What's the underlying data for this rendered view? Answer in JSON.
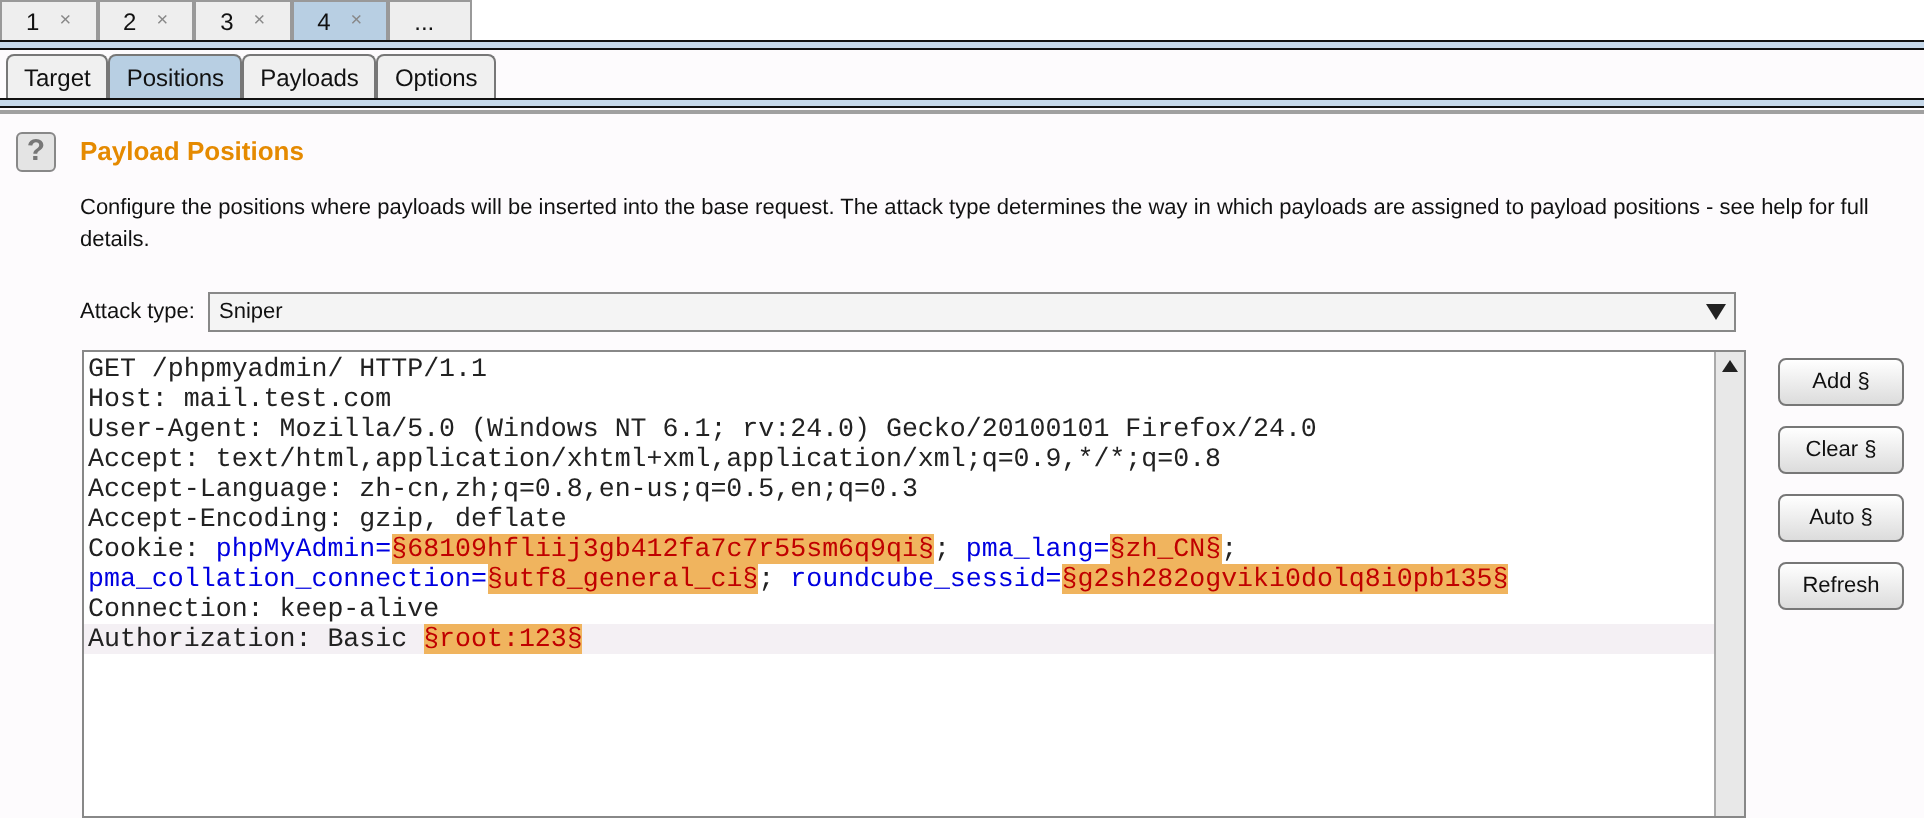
{
  "request_tabs": [
    {
      "label": "1",
      "close": "×",
      "selected": false
    },
    {
      "label": "2",
      "close": "×",
      "selected": false
    },
    {
      "label": "3",
      "close": "×",
      "selected": false
    },
    {
      "label": "4",
      "close": "×",
      "selected": true
    },
    {
      "label": "...",
      "selected": false
    }
  ],
  "section_tabs": [
    {
      "label": "Target",
      "selected": false
    },
    {
      "label": "Positions",
      "selected": true
    },
    {
      "label": "Payloads",
      "selected": false
    },
    {
      "label": "Options",
      "selected": false
    }
  ],
  "help_icon": "?",
  "title": "Payload Positions",
  "description": "Configure the positions where payloads will be inserted into the base request. The attack type determines the way in which payloads are assigned to payload positions - see help for full details.",
  "attack_type": {
    "label": "Attack type:",
    "value": "Sniper"
  },
  "request_lines": [
    {
      "current": false,
      "segments": [
        {
          "kind": "plain",
          "text": "GET /phpmyadmin/ HTTP/1.1"
        }
      ]
    },
    {
      "current": false,
      "segments": [
        {
          "kind": "plain",
          "text": "Host: mail.test.com"
        }
      ]
    },
    {
      "current": false,
      "segments": [
        {
          "kind": "plain",
          "text": "User-Agent: Mozilla/5.0 (Windows NT 6.1; rv:24.0) Gecko/20100101 Firefox/24.0"
        }
      ]
    },
    {
      "current": false,
      "segments": [
        {
          "kind": "plain",
          "text": "Accept: text/html,application/xhtml+xml,application/xml;q=0.9,*/*;q=0.8"
        }
      ]
    },
    {
      "current": false,
      "segments": [
        {
          "kind": "plain",
          "text": "Accept-Language: zh-cn,zh;q=0.8,en-us;q=0.5,en;q=0.3"
        }
      ]
    },
    {
      "current": false,
      "segments": [
        {
          "kind": "plain",
          "text": "Accept-Encoding: gzip, deflate"
        }
      ]
    },
    {
      "current": false,
      "segments": [
        {
          "kind": "plain",
          "text": "Cookie: "
        },
        {
          "kind": "param",
          "text": "phpMyAdmin="
        },
        {
          "kind": "payload",
          "text": "§68109hfliij3gb412fa7c7r55sm6q9qi§"
        },
        {
          "kind": "plain",
          "text": "; "
        },
        {
          "kind": "param",
          "text": "pma_lang="
        },
        {
          "kind": "payload",
          "text": "§zh_CN§"
        },
        {
          "kind": "plain",
          "text": ";"
        }
      ]
    },
    {
      "current": false,
      "segments": [
        {
          "kind": "param",
          "text": "pma_collation_connection="
        },
        {
          "kind": "payload",
          "text": "§utf8_general_ci§"
        },
        {
          "kind": "plain",
          "text": "; "
        },
        {
          "kind": "param",
          "text": "roundcube_sessid="
        },
        {
          "kind": "payload",
          "text": "§g2sh282ogviki0dolq8i0pb135§"
        }
      ]
    },
    {
      "current": false,
      "segments": [
        {
          "kind": "plain",
          "text": "Connection: keep-alive"
        }
      ]
    },
    {
      "current": true,
      "segments": [
        {
          "kind": "plain",
          "text": "Authorization: Basic "
        },
        {
          "kind": "payload",
          "text": "§root:123§"
        }
      ]
    }
  ],
  "buttons": [
    "Add §",
    "Clear §",
    "Auto §",
    "Refresh"
  ]
}
